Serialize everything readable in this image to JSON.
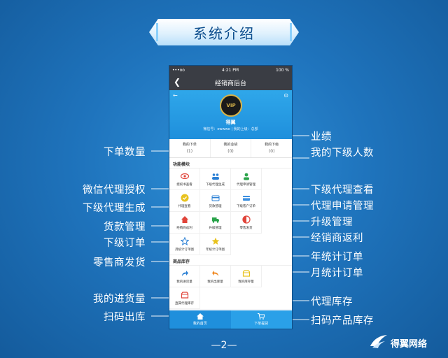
{
  "title": "系统介绍",
  "page_number": "—2—",
  "logo_text": "得翼网络",
  "phone": {
    "status": {
      "left": "•••oo",
      "time": "4:21 PM",
      "battery": "100 %"
    },
    "nav_title": "经销商后台",
    "user": {
      "name": "得翼",
      "info": "微信号：ewwwe | 我的上级：总部",
      "badge": "VIP"
    },
    "stats": [
      {
        "label": "我的下单",
        "value": "(1)"
      },
      {
        "label": "我的业绩",
        "value": "(0)"
      },
      {
        "label": "我的下级",
        "value": "(0)"
      }
    ],
    "section_features": "功能模块",
    "features": [
      {
        "label": "授权书查看",
        "icon": "eye-icon"
      },
      {
        "label": "下级代理生成",
        "icon": "group-icon"
      },
      {
        "label": "代理申请管理",
        "icon": "user-add-icon"
      },
      {
        "label": "代理查看",
        "icon": "check-badge-icon"
      },
      {
        "label": "货款管理",
        "icon": "card-icon"
      },
      {
        "label": "下级客户订单",
        "icon": "card-icon"
      },
      {
        "label": "经销商返利",
        "icon": "home-icon"
      },
      {
        "label": "升级管理",
        "icon": "truck-icon"
      },
      {
        "label": "零售发货",
        "icon": "half-circle-icon"
      },
      {
        "label": "月统计订单图",
        "icon": "star-outline-icon"
      },
      {
        "label": "年统计订单图",
        "icon": "star-filled-icon"
      }
    ],
    "section_stock": "商品库存",
    "stock": [
      {
        "label": "我的进货量",
        "icon": "share-icon"
      },
      {
        "label": "我的出库量",
        "icon": "reply-icon"
      },
      {
        "label": "我的库存量",
        "icon": "box-icon"
      },
      {
        "label": "直属代理库存",
        "icon": "box-icon"
      }
    ],
    "tabs": [
      {
        "label": "我的首页"
      },
      {
        "label": "下单提货"
      }
    ]
  },
  "callouts_left": [
    "下单数量",
    "微信代理授权",
    "下级代理生成",
    "货款管理",
    "下级订单",
    "零售商发货",
    "我的进货量",
    "扫码出库"
  ],
  "callouts_right": [
    "业绩",
    "我的下级人数",
    "下级代理查看",
    "代理申请管理",
    "升级管理",
    "经销商返利",
    "年统计订单",
    "月统计订单",
    "代理库存",
    "扫码产品库存"
  ],
  "colors": {
    "background": "#1f74bd",
    "phone_header": "#1f8fdc",
    "banner_text": "#0b4c8c"
  }
}
